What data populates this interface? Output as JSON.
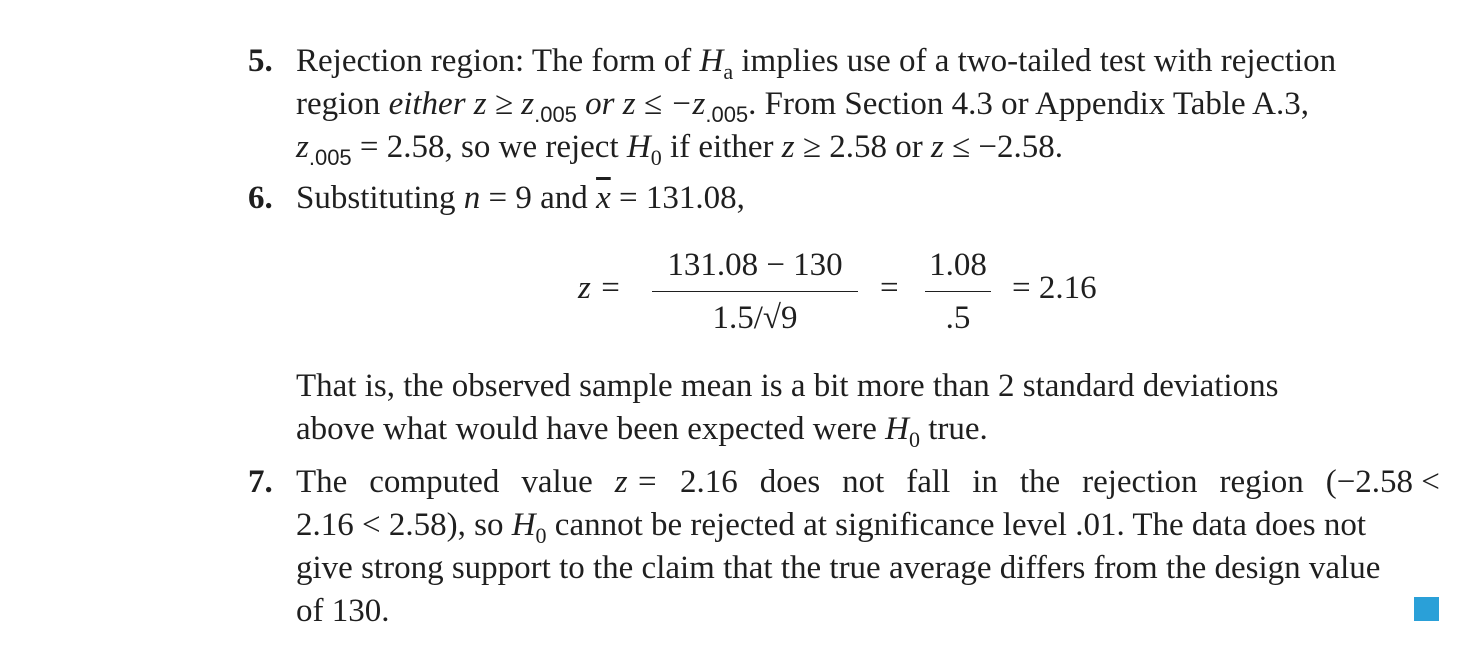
{
  "step5": {
    "number": "5.",
    "l1_a": "Rejection region: The form of",
    "l1_H": "H",
    "l1_Hsub": "a",
    "l1_b": "implies use of a two-tailed test with rejection",
    "l2_a": "region",
    "l2_either": "either z ≥ z",
    "l2_sub1": ".005",
    "l2_or": "or z ≤ −z",
    "l2_sub2": ".005",
    "l2_b": ". From Section 4.3 or Appendix Table A.3,",
    "l3_z": "z",
    "l3_sub": ".005",
    "l3_a": "= 2.58, so we reject",
    "l3_H": "H",
    "l3_Hsub": "0",
    "l3_b": "if either",
    "l3_c": "z",
    "l3_d": "≥ 2.58 or",
    "l3_e": "z",
    "l3_f": "≤ −2.58."
  },
  "step6": {
    "number": "6.",
    "l1_a": "Substituting",
    "l1_n": "n",
    "l1_b": "= 9 and",
    "l1_x": "x",
    "l1_c": "= 131.08,",
    "eq_lhs": "z =",
    "frac1_num": "131.08 − 130",
    "frac1_den": "1.5/√9",
    "eq_mid": "=",
    "frac2_num": "1.08",
    "frac2_den": ".5",
    "eq_rhs": "= 2.16",
    "p1": "That is, the observed sample mean is a bit more than 2 standard deviations",
    "p2_a": "above what would have been expected were",
    "p2_H": "H",
    "p2_Hsub": "0",
    "p2_b": "true."
  },
  "step7": {
    "number": "7.",
    "l1": [
      "The",
      "computed",
      "value",
      "z =",
      "2.16",
      "does",
      "not",
      "fall",
      "in",
      "the",
      "rejection",
      "region",
      "(−2.58 <"
    ],
    "l2_a": "2.16 < 2.58), so",
    "l2_H": "H",
    "l2_Hsub": "0",
    "l2_b": "cannot be rejected at significance level .01. The data does not",
    "l3": "give strong support to the claim that the true average differs from the design value",
    "l4": "of 130."
  },
  "colors": {
    "end_marker": "#2aa0d8"
  }
}
